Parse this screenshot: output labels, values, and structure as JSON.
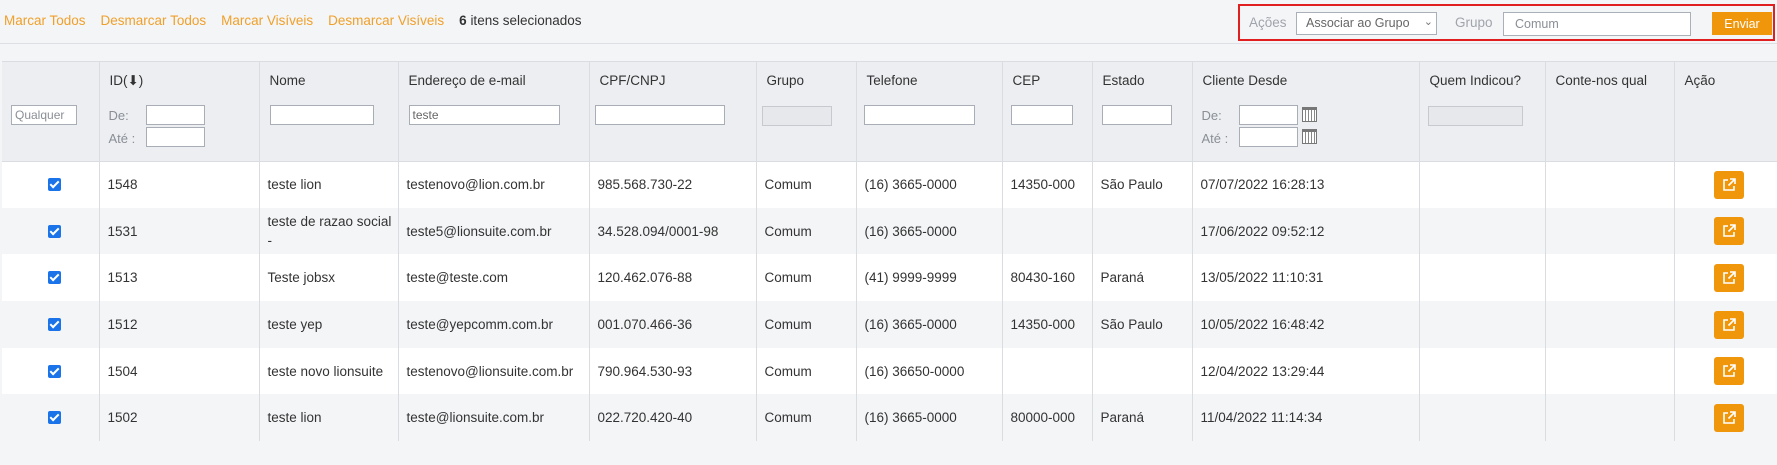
{
  "selection": {
    "mark_all": "Marcar Todos",
    "unmark_all": "Desmarcar Todos",
    "mark_visible": "Marcar Visíveis",
    "unmark_visible": "Desmarcar Visíveis",
    "count": "6",
    "count_suffix": "itens selecionados"
  },
  "actions": {
    "actions_label": "Ações",
    "actions_select": "Associar ao Grupo",
    "group_label": "Grupo",
    "group_value": "Comum",
    "send_label": "Enviar"
  },
  "table": {
    "headers": [
      "",
      "ID(⬇)",
      "Nome",
      "Endereço de e-mail",
      "CPF/CNPJ",
      "Grupo",
      "Telefone",
      "CEP",
      "Estado",
      "Cliente Desde",
      "Quem Indicou?",
      "Conte-nos qual",
      "Ação"
    ],
    "filters": {
      "any_placeholder": "Qualquer",
      "from_label": "De:",
      "to_label": "Até :",
      "email_value": "teste"
    },
    "rows": [
      {
        "id": "1548",
        "nome": "teste lion",
        "email": "testenovo@lion.com.br",
        "cpf": "985.568.730-22",
        "grupo": "Comum",
        "telefone": "(16) 3665-0000",
        "cep": "14350-000",
        "estado": "São Paulo",
        "desde": "07/07/2022 16:28:13"
      },
      {
        "id": "1531",
        "nome": "teste de razao social -",
        "email": "teste5@lionsuite.com.br",
        "cpf": "34.528.094/0001-98",
        "grupo": "Comum",
        "telefone": "(16) 3665-0000",
        "cep": "",
        "estado": "",
        "desde": "17/06/2022 09:52:12"
      },
      {
        "id": "1513",
        "nome": "Teste jobsx",
        "email": "teste@teste.com",
        "cpf": "120.462.076-88",
        "grupo": "Comum",
        "telefone": "(41) 9999-9999",
        "cep": "80430-160",
        "estado": "Paraná",
        "desde": "13/05/2022 11:10:31"
      },
      {
        "id": "1512",
        "nome": "teste yep",
        "email": "teste@yepcomm.com.br",
        "cpf": "001.070.466-36",
        "grupo": "Comum",
        "telefone": "(16) 3665-0000",
        "cep": "14350-000",
        "estado": "São Paulo",
        "desde": "10/05/2022 16:48:42"
      },
      {
        "id": "1504",
        "nome": "teste novo lionsuite",
        "email": "testenovo@lionsuite.com.br",
        "cpf": "790.964.530-93",
        "grupo": "Comum",
        "telefone": "(16) 36650-0000",
        "cep": "",
        "estado": "",
        "desde": "12/04/2022 13:29:44"
      },
      {
        "id": "1502",
        "nome": "teste lion",
        "email": "teste@lionsuite.com.br",
        "cpf": "022.720.420-40",
        "grupo": "Comum",
        "telefone": "(16) 3665-0000",
        "cep": "80000-000",
        "estado": "Paraná",
        "desde": "11/04/2022 11:14:34"
      }
    ]
  },
  "icons": {
    "row_checkbox": "checkbox-checked",
    "action": "external-link-icon",
    "calendar": "calendar-icon",
    "sort": "sort-down-icon"
  },
  "colors": {
    "link": "#f0a02a",
    "button": "#f0960a",
    "highlight_border": "#e02020",
    "checkbox": "#1a73e8"
  }
}
